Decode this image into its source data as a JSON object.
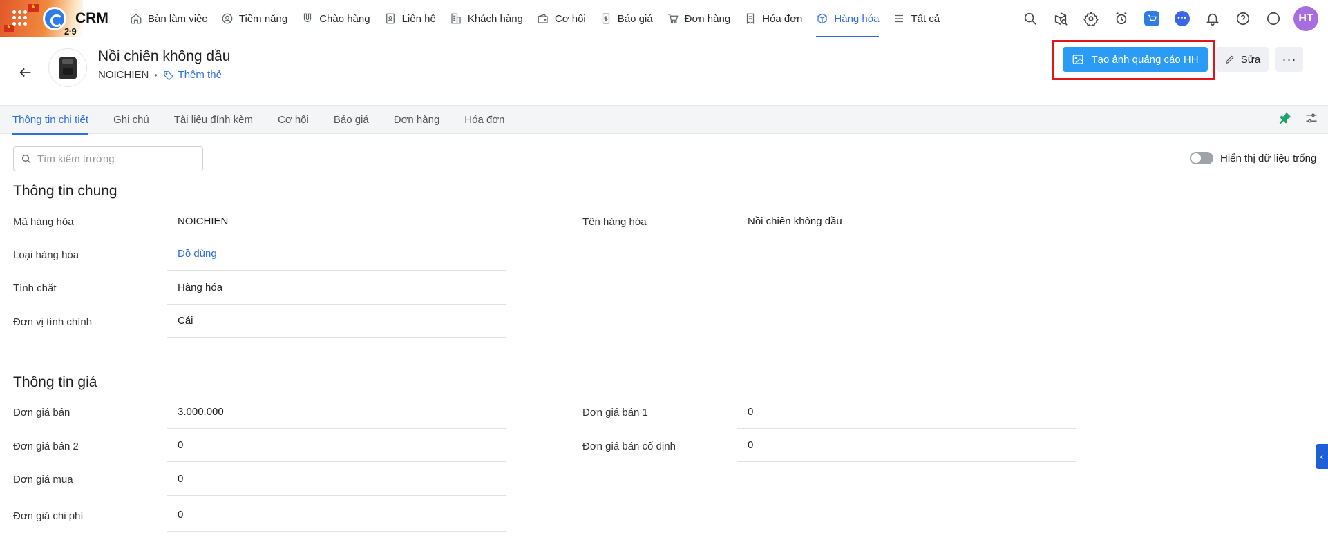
{
  "app": {
    "name": "CRM",
    "date_badge": "2·9"
  },
  "nav": {
    "items": [
      {
        "label": "Bàn làm việc",
        "icon": "home-icon"
      },
      {
        "label": "Tiềm năng",
        "icon": "user-circle-icon"
      },
      {
        "label": "Chào hàng",
        "icon": "magnet-icon"
      },
      {
        "label": "Liên hệ",
        "icon": "contact-icon"
      },
      {
        "label": "Khách hàng",
        "icon": "building-icon"
      },
      {
        "label": "Cơ hội",
        "icon": "wallet-icon"
      },
      {
        "label": "Báo giá",
        "icon": "quote-icon"
      },
      {
        "label": "Đơn hàng",
        "icon": "cart-icon"
      },
      {
        "label": "Hóa đơn",
        "icon": "invoice-icon"
      },
      {
        "label": "Hàng hóa",
        "icon": "box-icon",
        "active": true
      },
      {
        "label": "Tất cả",
        "icon": "menu-icon"
      }
    ]
  },
  "user": {
    "initials": "HT"
  },
  "product": {
    "name": "Nồi chiên không dầu",
    "code": "NOICHIEN",
    "add_tag_label": "Thêm thẻ"
  },
  "actions": {
    "create_ad_label": "Tạo ảnh quảng cáo HH",
    "edit_label": "Sửa",
    "more_label": "···"
  },
  "tabs": [
    {
      "label": "Thông tin chi tiết",
      "active": true
    },
    {
      "label": "Ghi chú"
    },
    {
      "label": "Tài liệu đính kèm"
    },
    {
      "label": "Cơ hội"
    },
    {
      "label": "Báo giá"
    },
    {
      "label": "Đơn hàng"
    },
    {
      "label": "Hóa đơn"
    }
  ],
  "search": {
    "placeholder": "Tìm kiếm trường",
    "value": ""
  },
  "toggle": {
    "label": "Hiển thị dữ liệu trống",
    "on": false
  },
  "sections": {
    "general": {
      "title": "Thông tin chung",
      "fields": {
        "ma_hang_hoa": {
          "label": "Mã hàng hóa",
          "value": "NOICHIEN"
        },
        "ten_hang_hoa": {
          "label": "Tên hàng hóa",
          "value": "Nồi chiên không dầu"
        },
        "loai_hang_hoa": {
          "label": "Loại hàng hóa",
          "value": "Đồ dùng"
        },
        "tinh_chat": {
          "label": "Tính chất",
          "value": "Hàng hóa"
        },
        "don_vi_tinh": {
          "label": "Đơn vị tính chính",
          "value": "Cái"
        }
      }
    },
    "price": {
      "title": "Thông tin giá",
      "fields": {
        "don_gia_ban": {
          "label": "Đơn giá bán",
          "value": "3.000.000"
        },
        "don_gia_ban_1": {
          "label": "Đơn giá bán 1",
          "value": "0"
        },
        "don_gia_ban_2": {
          "label": "Đơn giá bán 2",
          "value": "0"
        },
        "don_gia_ban_co_dinh": {
          "label": "Đơn giá bán cố định",
          "value": "0"
        },
        "don_gia_mua": {
          "label": "Đơn giá mua",
          "value": "0"
        },
        "don_gia_chi_phi": {
          "label": "Đơn giá chi phí",
          "value": "0"
        }
      }
    }
  }
}
